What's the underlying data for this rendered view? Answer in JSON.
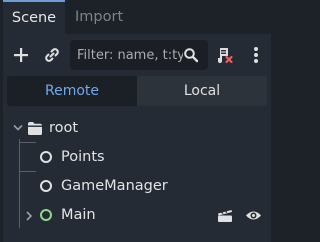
{
  "tabs": [
    {
      "label": "Scene"
    },
    {
      "label": "Import"
    }
  ],
  "toolbar": {
    "add_icon": "plus-icon",
    "link_icon": "link-icon",
    "filter_placeholder": "Filter: name, t:type, g:group",
    "filter_icon": "search-icon",
    "script_icon": "script-remove-icon",
    "more_icon": "vertical-ellipsis-icon"
  },
  "toggle": {
    "remote": "Remote",
    "local": "Local",
    "selected": "Remote"
  },
  "tree": {
    "root": {
      "label": "root",
      "icon": "node-folder-icon",
      "expanded": true
    },
    "children": [
      {
        "label": "Points",
        "icon": "node-circle-icon"
      },
      {
        "label": "GameManager",
        "icon": "node-circle-icon"
      },
      {
        "label": "Main",
        "icon": "node-circle-icon",
        "collapsed": true,
        "badges": [
          "clapperboard-icon",
          "eye-icon"
        ]
      }
    ]
  },
  "colors": {
    "accent": "#73a8ea",
    "tab_border": "#709cd6",
    "node3d_green": "#8ed987",
    "panel": "#252b34",
    "background": "#1d2229"
  }
}
